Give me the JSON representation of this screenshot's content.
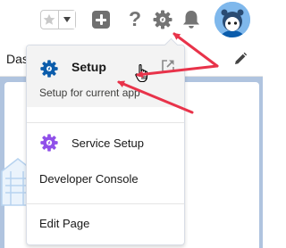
{
  "header": {
    "icons": [
      "star-icon",
      "chevron-down-icon",
      "add-icon",
      "question-mark-icon",
      "gear-icon",
      "bell-icon",
      "avatar"
    ],
    "help_glyph": "?"
  },
  "tab_bar": {
    "tab_label": "Das"
  },
  "setup_menu": {
    "setup": {
      "label": "Setup",
      "description": "Setup for current app",
      "icon": "gear-icon",
      "secondary_icon": "external-link-icon"
    },
    "items": [
      {
        "label": "Service Setup",
        "icon": "service-gear-icon"
      },
      {
        "label": "Developer Console"
      },
      {
        "label": "Edit Page"
      }
    ]
  },
  "annotations": {
    "arrow_color": "#e8334a",
    "count": 3
  },
  "colors": {
    "setup_icon": "#0b5cab",
    "service_icon": "#9050e9",
    "header_icons": "#747474",
    "content_bg": "#b0c4df"
  }
}
